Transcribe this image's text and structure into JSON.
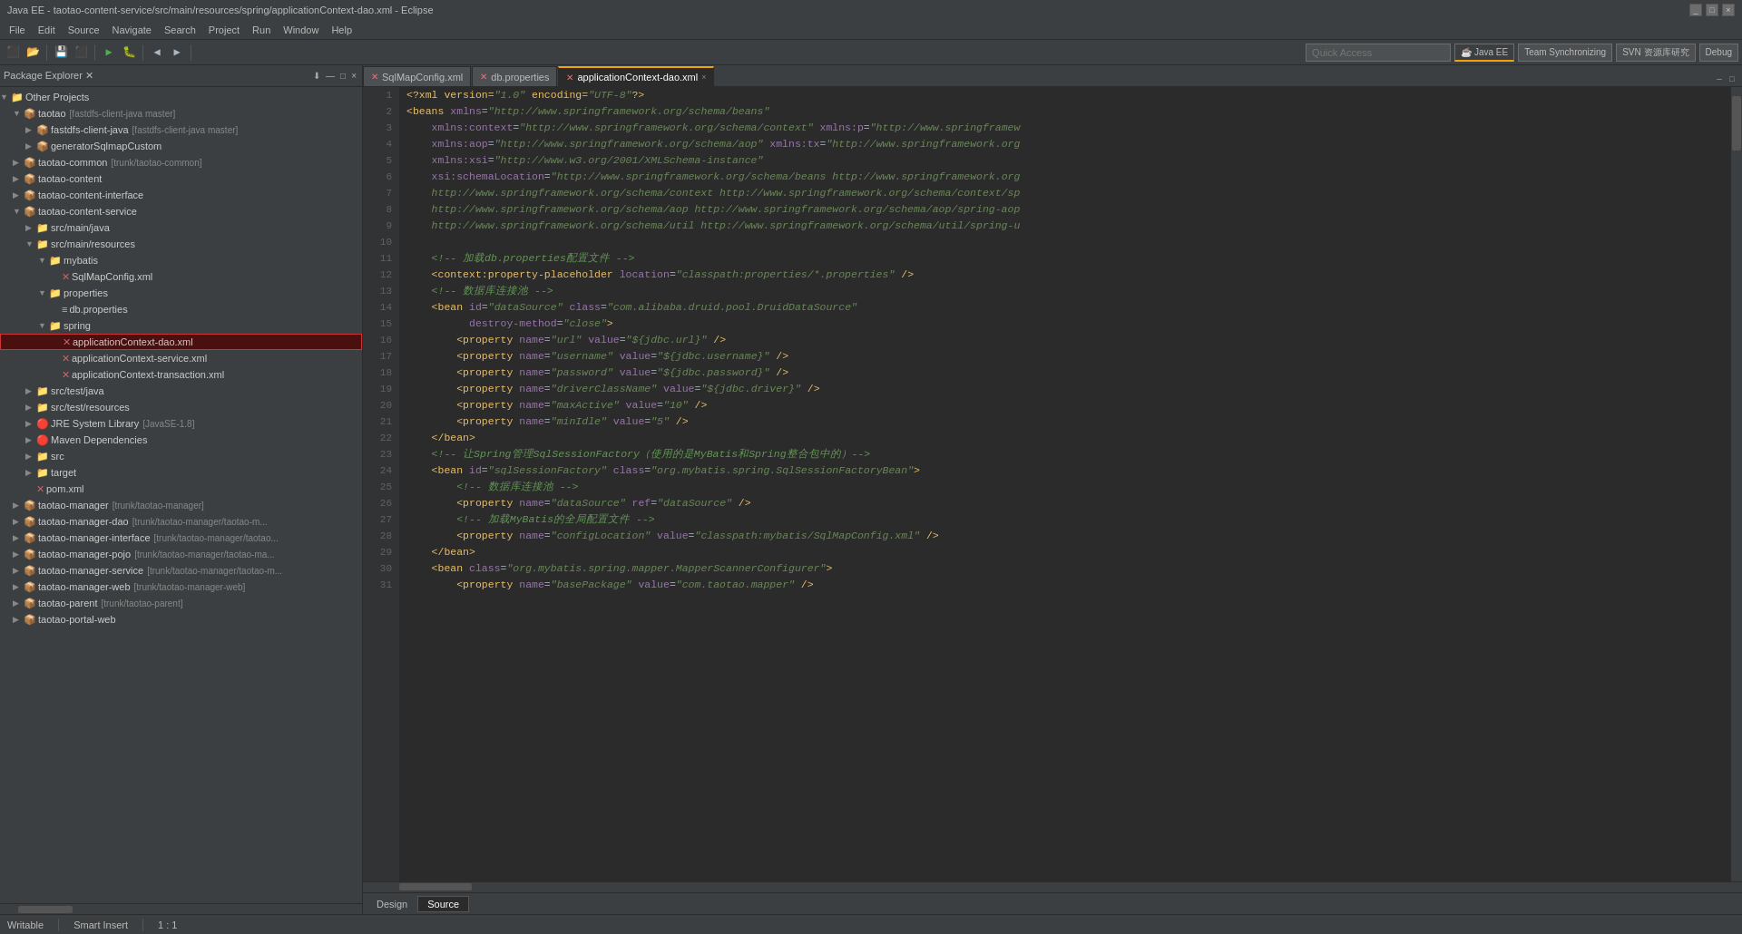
{
  "titlebar": {
    "title": "Java EE - taotao-content-service/src/main/resources/spring/applicationContext-dao.xml - Eclipse",
    "controls": [
      "_",
      "□",
      "×"
    ]
  },
  "menubar": {
    "items": [
      "File",
      "Edit",
      "Source",
      "Navigate",
      "Search",
      "Project",
      "Run",
      "Window",
      "Help"
    ]
  },
  "toolbar": {
    "quick_access_placeholder": "Quick Access"
  },
  "perspectives": {
    "items": [
      "Java EE",
      "Team Synchronizing",
      "SVN 资源库研究",
      "Debug"
    ]
  },
  "left_panel": {
    "title": "Package Explorer",
    "title_icon": "×",
    "tree": [
      {
        "level": 0,
        "label": "Other Projects",
        "type": "folder",
        "expanded": true,
        "arrow": "▼"
      },
      {
        "level": 1,
        "label": "taotao",
        "type": "project",
        "expanded": true,
        "arrow": "▼",
        "sublabel": "[fastdfs-client-java master]"
      },
      {
        "level": 2,
        "label": "fastdfs-client-java",
        "type": "project",
        "expanded": false,
        "arrow": "▶",
        "sublabel": "[fastdfs-client-java master]"
      },
      {
        "level": 2,
        "label": "generatorSqlmapCustom",
        "type": "project",
        "expanded": false,
        "arrow": "▶",
        "sublabel": ""
      },
      {
        "level": 1,
        "label": "taotao-common",
        "type": "project",
        "expanded": false,
        "arrow": "▶",
        "sublabel": "[trunk/taotao-common]"
      },
      {
        "level": 1,
        "label": "taotao-content",
        "type": "project",
        "expanded": false,
        "arrow": "▶",
        "sublabel": ""
      },
      {
        "level": 1,
        "label": "taotao-content-interface",
        "type": "project",
        "expanded": false,
        "arrow": "▶",
        "sublabel": ""
      },
      {
        "level": 1,
        "label": "taotao-content-service",
        "type": "project",
        "expanded": true,
        "arrow": "▼",
        "sublabel": ""
      },
      {
        "level": 2,
        "label": "src/main/java",
        "type": "folder",
        "expanded": false,
        "arrow": "▶",
        "sublabel": ""
      },
      {
        "level": 2,
        "label": "src/main/resources",
        "type": "folder",
        "expanded": true,
        "arrow": "▼",
        "sublabel": ""
      },
      {
        "level": 3,
        "label": "mybatis",
        "type": "folder",
        "expanded": true,
        "arrow": "▼",
        "sublabel": ""
      },
      {
        "level": 4,
        "label": "SqlMapConfig.xml",
        "type": "xml",
        "expanded": false,
        "arrow": "",
        "sublabel": ""
      },
      {
        "level": 3,
        "label": "properties",
        "type": "folder",
        "expanded": true,
        "arrow": "▼",
        "sublabel": ""
      },
      {
        "level": 4,
        "label": "db.properties",
        "type": "props",
        "expanded": false,
        "arrow": "",
        "sublabel": ""
      },
      {
        "level": 3,
        "label": "spring",
        "type": "folder",
        "expanded": true,
        "arrow": "▼",
        "sublabel": ""
      },
      {
        "level": 4,
        "label": "applicationContext-dao.xml",
        "type": "xml",
        "expanded": false,
        "arrow": "",
        "sublabel": "",
        "highlighted": true
      },
      {
        "level": 4,
        "label": "applicationContext-service.xml",
        "type": "xml",
        "expanded": false,
        "arrow": "",
        "sublabel": ""
      },
      {
        "level": 4,
        "label": "applicationContext-transaction.xml",
        "type": "xml",
        "expanded": false,
        "arrow": "",
        "sublabel": ""
      },
      {
        "level": 2,
        "label": "src/test/java",
        "type": "folder",
        "expanded": false,
        "arrow": "▶",
        "sublabel": ""
      },
      {
        "level": 2,
        "label": "src/test/resources",
        "type": "folder",
        "expanded": false,
        "arrow": "▶",
        "sublabel": ""
      },
      {
        "level": 2,
        "label": "JRE System Library",
        "type": "jar",
        "expanded": false,
        "arrow": "▶",
        "sublabel": "[JavaSE-1.8]"
      },
      {
        "level": 2,
        "label": "Maven Dependencies",
        "type": "jar",
        "expanded": false,
        "arrow": "▶",
        "sublabel": ""
      },
      {
        "level": 2,
        "label": "src",
        "type": "folder",
        "expanded": false,
        "arrow": "▶",
        "sublabel": ""
      },
      {
        "level": 2,
        "label": "target",
        "type": "folder",
        "expanded": false,
        "arrow": "▶",
        "sublabel": ""
      },
      {
        "level": 2,
        "label": "pom.xml",
        "type": "xml",
        "expanded": false,
        "arrow": "",
        "sublabel": ""
      },
      {
        "level": 1,
        "label": "taotao-manager",
        "type": "project",
        "expanded": false,
        "arrow": "▶",
        "sublabel": "[trunk/taotao-manager]"
      },
      {
        "level": 1,
        "label": "taotao-manager-dao",
        "type": "project",
        "expanded": false,
        "arrow": "▶",
        "sublabel": "[trunk/taotao-manager/taotao-m..."
      },
      {
        "level": 1,
        "label": "taotao-manager-interface",
        "type": "project",
        "expanded": false,
        "arrow": "▶",
        "sublabel": "[trunk/taotao-manager/taotao..."
      },
      {
        "level": 1,
        "label": "taotao-manager-pojo",
        "type": "project",
        "expanded": false,
        "arrow": "▶",
        "sublabel": "[trunk/taotao-manager/taotao-ma..."
      },
      {
        "level": 1,
        "label": "taotao-manager-service",
        "type": "project",
        "expanded": false,
        "arrow": "▶",
        "sublabel": "[trunk/taotao-manager/taotao-m..."
      },
      {
        "level": 1,
        "label": "taotao-manager-web",
        "type": "project",
        "expanded": false,
        "arrow": "▶",
        "sublabel": "[trunk/taotao-manager-web]"
      },
      {
        "level": 1,
        "label": "taotao-parent",
        "type": "project",
        "expanded": false,
        "arrow": "▶",
        "sublabel": "[trunk/taotao-parent]"
      },
      {
        "level": 1,
        "label": "taotao-portal-web",
        "type": "project",
        "expanded": false,
        "arrow": "▶",
        "sublabel": ""
      }
    ]
  },
  "editor": {
    "tabs": [
      {
        "label": "SqlMapConfig.xml",
        "active": false,
        "type": "xml"
      },
      {
        "label": "db.properties",
        "active": false,
        "type": "props"
      },
      {
        "label": "applicationContext-dao.xml",
        "active": true,
        "type": "xml"
      }
    ],
    "bottom_tabs": [
      {
        "label": "Design",
        "active": false
      },
      {
        "label": "Source",
        "active": true
      }
    ],
    "lines": [
      {
        "num": 1,
        "content": "<?xml version=\"1.0\" encoding=\"UTF-8\"?>"
      },
      {
        "num": 2,
        "content": "<beans xmlns=\"http://www.springframework.org/schema/beans\""
      },
      {
        "num": 3,
        "content": "    xmlns:context=\"http://www.springframework.org/schema/context\" xmlns:p=\"http://www.springframew"
      },
      {
        "num": 4,
        "content": "    xmlns:aop=\"http://www.springframework.org/schema/aop\" xmlns:tx=\"http://www.springframework.org"
      },
      {
        "num": 5,
        "content": "    xmlns:xsi=\"http://www.w3.org/2001/XMLSchema-instance\""
      },
      {
        "num": 6,
        "content": "    xsi:schemaLocation=\"http://www.springframework.org/schema/beans http://www.springframework.org"
      },
      {
        "num": 7,
        "content": "    http://www.springframework.org/schema/context http://www.springframework.org/schema/context/sp"
      },
      {
        "num": 8,
        "content": "    http://www.springframework.org/schema/aop http://www.springframework.org/schema/aop/spring-aop"
      },
      {
        "num": 9,
        "content": "    http://www.springframework.org/schema/util http://www.springframework.org/schema/util/spring-u"
      },
      {
        "num": 10,
        "content": ""
      },
      {
        "num": 11,
        "content": "    <!-- 加载db.properties配置文件 -->"
      },
      {
        "num": 12,
        "content": "    <context:property-placeholder location=\"classpath:properties/*.properties\" />"
      },
      {
        "num": 13,
        "content": "    <!-- 数据库连接池 -->"
      },
      {
        "num": 14,
        "content": "    <bean id=\"dataSource\" class=\"com.alibaba.druid.pool.DruidDataSource\""
      },
      {
        "num": 15,
        "content": "          destroy-method=\"close\">"
      },
      {
        "num": 16,
        "content": "        <property name=\"url\" value=\"${jdbc.url}\" />"
      },
      {
        "num": 17,
        "content": "        <property name=\"username\" value=\"${jdbc.username}\" />"
      },
      {
        "num": 18,
        "content": "        <property name=\"password\" value=\"${jdbc.password}\" />"
      },
      {
        "num": 19,
        "content": "        <property name=\"driverClassName\" value=\"${jdbc.driver}\" />"
      },
      {
        "num": 20,
        "content": "        <property name=\"maxActive\" value=\"10\" />"
      },
      {
        "num": 21,
        "content": "        <property name=\"minIdle\" value=\"5\" />"
      },
      {
        "num": 22,
        "content": "    </bean>"
      },
      {
        "num": 23,
        "content": "    <!-- 让Spring管理SqlSessionFactory（使用的是MyBatis和Spring整合包中的）-->"
      },
      {
        "num": 24,
        "content": "    <bean id=\"sqlSessionFactory\" class=\"org.mybatis.spring.SqlSessionFactoryBean\">"
      },
      {
        "num": 25,
        "content": "        <!-- 数据库连接池 -->"
      },
      {
        "num": 26,
        "content": "        <property name=\"dataSource\" ref=\"dataSource\" />"
      },
      {
        "num": 27,
        "content": "        <!-- 加载MyBatis的全局配置文件 -->"
      },
      {
        "num": 28,
        "content": "        <property name=\"configLocation\" value=\"classpath:mybatis/SqlMapConfig.xml\" />"
      },
      {
        "num": 29,
        "content": "    </bean>"
      },
      {
        "num": 30,
        "content": "    <bean class=\"org.mybatis.spring.mapper.MapperScannerConfigurer\">"
      },
      {
        "num": 31,
        "content": "        <property name=\"basePackage\" value=\"com.taotao.mapper\" />"
      }
    ]
  },
  "statusbar": {
    "writable": "Writable",
    "insert_mode": "Smart Insert",
    "position": "1 : 1"
  }
}
